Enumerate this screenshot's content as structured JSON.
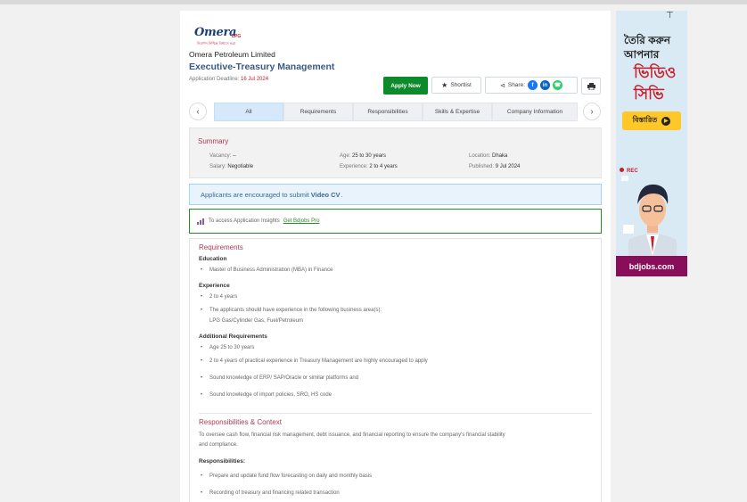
{
  "company": {
    "logo_text": "Omera",
    "logo_sub": "LPG",
    "logo_tagline": "নিরাপদ নিশ্চিন্ত বিশ্বাসে ভরা",
    "name": "Omera Petroleum Limited"
  },
  "job": {
    "title": "Executive-Treasury Management",
    "deadline_label": "Application Deadline:",
    "deadline": "16 Jul 2024"
  },
  "actions": {
    "apply": "Apply Now",
    "shortlist": "Shortlist",
    "share": "Share:",
    "print_icon": "printer-icon"
  },
  "tabs": [
    "All",
    "Requirements",
    "Responsibilities",
    "Skills & Expertise",
    "Company Information"
  ],
  "summary": {
    "title": "Summary",
    "vacancy_label": "Vacancy:",
    "vacancy": "--",
    "age_label": "Age:",
    "age": "25 to 30 years",
    "location_label": "Location:",
    "location": "Dhaka",
    "salary_label": "Salary:",
    "salary": "Negotiable",
    "experience_label": "Experience:",
    "experience": "2 to 4 years",
    "published_label": "Published:",
    "published": "9 Jul 2024"
  },
  "notice": {
    "prefix": "Applicants are encouraged to submit",
    "highlight": "Video CV",
    "suffix": "."
  },
  "insight": {
    "text": "To access Application Insights",
    "link": "Get Bdjobs Pro"
  },
  "requirements": {
    "title": "Requirements",
    "education_label": "Education",
    "education": [
      "Master of Business Administration (MBA) in Finance"
    ],
    "experience_label": "Experience",
    "experience": [
      "2 to 4 years",
      "The applicants should have experience in the following business area(s):"
    ],
    "experience_areas": "LPG Gas/Cylinder Gas, Fuel/Petroleum",
    "additional_label": "Additional Requirements",
    "additional": [
      "Age 25 to 30 years",
      "2 to 4 years of practical experience in Treasury Management are highly encouraged to apply",
      "Sound knowledge of ERP/ SAP/Oracle or similar platforms and",
      "Sound knowledge of import policies, SRO, HS code"
    ]
  },
  "responsibilities": {
    "title": "Responsibilities & Context",
    "context_line1": "To oversee cash flow, financial risk management, debt issuance, and financial reporting to ensure the company's financial stability",
    "context_line2": "and compliance.",
    "label": "Responsibilities:",
    "items": [
      "Prepare and update fund flow forecasting on daily and monthly basis",
      "Recording of treasury and financing related transaction"
    ]
  },
  "ad": {
    "line1": "তৈরি করুন",
    "line2": "আপনার",
    "line3": "ভিডিও",
    "line4": "সিভি",
    "cta": "বিস্তারিত",
    "rec": "REC",
    "footer": "bdjobs.com"
  },
  "colors": {
    "apply_green": "#0d8a2c",
    "title_blue": "#3a5a86",
    "section_red": "#b03a55",
    "ad_footer": "#880e5a",
    "ad_badge": "#ffc727"
  }
}
